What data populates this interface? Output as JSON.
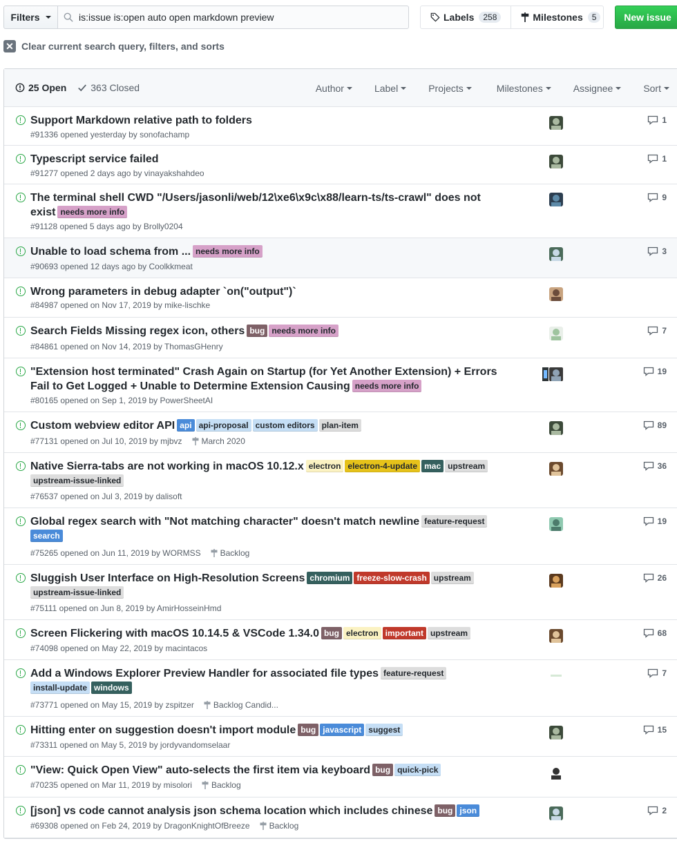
{
  "toolbar": {
    "filters_label": "Filters",
    "search_value": "is:issue is:open auto open markdown preview",
    "labels_label": "Labels",
    "labels_count": "258",
    "milestones_label": "Milestones",
    "milestones_count": "5",
    "new_issue_label": "New issue"
  },
  "clear_filters_label": "Clear current search query, filters, and sorts",
  "header": {
    "open_label": "25 Open",
    "closed_label": "363 Closed",
    "menus": [
      "Author",
      "Label",
      "Projects",
      "Milestones",
      "Assignee",
      "Sort"
    ]
  },
  "label_colors": {
    "needs more info": {
      "bg": "#d6a1c8",
      "fg": "#24292e"
    },
    "bug": {
      "bg": "#7e6167",
      "fg": "#ffffff"
    },
    "api": {
      "bg": "#4a8bd9",
      "fg": "#ffffff"
    },
    "api-proposal": {
      "bg": "#c5def5",
      "fg": "#24292e"
    },
    "custom editors": {
      "bg": "#c5def5",
      "fg": "#24292e"
    },
    "plan-item": {
      "bg": "#dddddd",
      "fg": "#24292e"
    },
    "electron": {
      "bg": "#fbf2c2",
      "fg": "#24292e"
    },
    "electron-4-update": {
      "bg": "#e6c21a",
      "fg": "#24292e"
    },
    "mac": {
      "bg": "#35605e",
      "fg": "#ffffff"
    },
    "upstream": {
      "bg": "#dddddd",
      "fg": "#24292e"
    },
    "upstream-issue-linked": {
      "bg": "#dddddd",
      "fg": "#24292e"
    },
    "feature-request": {
      "bg": "#dddddd",
      "fg": "#24292e"
    },
    "search": {
      "bg": "#4a8bd9",
      "fg": "#ffffff"
    },
    "chromium": {
      "bg": "#35605e",
      "fg": "#ffffff"
    },
    "freeze-slow-crash": {
      "bg": "#c0392b",
      "fg": "#ffffff"
    },
    "important": {
      "bg": "#c0392b",
      "fg": "#ffffff"
    },
    "install-update": {
      "bg": "#c5def5",
      "fg": "#24292e"
    },
    "windows": {
      "bg": "#35605e",
      "fg": "#ffffff"
    },
    "javascript": {
      "bg": "#4a8bd9",
      "fg": "#ffffff"
    },
    "suggest": {
      "bg": "#c5def5",
      "fg": "#24292e"
    },
    "quick-pick": {
      "bg": "#c5def5",
      "fg": "#24292e"
    },
    "json": {
      "bg": "#4a8bd9",
      "fg": "#ffffff"
    }
  },
  "issues": [
    {
      "title": "Support Markdown relative path to folders",
      "labels": [],
      "meta": "#91336 opened yesterday by sonofachamp",
      "milestone": "",
      "comments": "1"
    },
    {
      "title": "Typescript service failed",
      "labels": [],
      "meta": "#91277 opened 2 days ago by vinayakshahdeo",
      "milestone": "",
      "comments": "1"
    },
    {
      "title": "The terminal shell CWD \"/Users/jasonli/web/12\\xe6\\x9c\\x88/learn-ts/ts-crawl\" does not exist",
      "labels": [
        "needs more info"
      ],
      "meta": "#91128 opened 5 days ago by Brolly0204",
      "milestone": "",
      "comments": "9"
    },
    {
      "title": "Unable to load schema from ...",
      "labels": [
        "needs more info"
      ],
      "meta": "#90693 opened 12 days ago by Coolkkmeat",
      "milestone": "",
      "comments": "3"
    },
    {
      "title": "Wrong parameters in debug adapter `on(\"output\")`",
      "labels": [],
      "meta": "#84987 opened on Nov 17, 2019 by mike-lischke",
      "milestone": "",
      "comments": ""
    },
    {
      "title": "Search Fields Missing regex icon, others",
      "labels": [
        "bug",
        "needs more info"
      ],
      "meta": "#84861 opened on Nov 14, 2019 by ThomasGHenry",
      "milestone": "",
      "comments": "7"
    },
    {
      "title": "\"Extension host terminated\" Crash Again on Startup (for Yet Another Extension) + Errors Fail to Get Logged + Unable to Determine Extension Causing",
      "labels": [
        "needs more info"
      ],
      "meta": "#80165 opened on Sep 1, 2019 by PowerSheetAI",
      "milestone": "",
      "comments": "19"
    },
    {
      "title": "Custom webview editor API",
      "labels": [
        "api",
        "api-proposal",
        "custom editors",
        "plan-item"
      ],
      "meta": "#77131 opened on Jul 10, 2019 by mjbvz",
      "milestone": "March 2020",
      "comments": "89"
    },
    {
      "title": "Native Sierra-tabs are not working in macOS 10.12.x",
      "labels": [
        "electron",
        "electron-4-update",
        "mac",
        "upstream",
        "upstream-issue-linked"
      ],
      "meta": "#76537 opened on Jul 3, 2019 by dalisoft",
      "milestone": "",
      "comments": "36"
    },
    {
      "title": "Global regex search with \"Not matching character\" doesn't match newline",
      "labels": [
        "feature-request",
        "search"
      ],
      "meta": "#75265 opened on Jun 11, 2019 by WORMSS",
      "milestone": "Backlog",
      "comments": "19"
    },
    {
      "title": "Sluggish User Interface on High-Resolution Screens",
      "labels": [
        "chromium",
        "freeze-slow-crash",
        "upstream",
        "upstream-issue-linked"
      ],
      "meta": "#75111 opened on Jun 8, 2019 by AmirHosseinHmd",
      "milestone": "",
      "comments": "26"
    },
    {
      "title": "Screen Flickering with macOS 10.14.5 & VSCode 1.34.0",
      "labels": [
        "bug",
        "electron",
        "important",
        "upstream"
      ],
      "meta": "#74098 opened on May 22, 2019 by macintacos",
      "milestone": "",
      "comments": "68"
    },
    {
      "title": "Add a Windows Explorer Preview Handler for associated file types",
      "labels": [
        "feature-request",
        "install-update",
        "windows"
      ],
      "meta": "#73771 opened on May 15, 2019 by zspitzer",
      "milestone": "Backlog Candid...",
      "comments": "7"
    },
    {
      "title": "Hitting enter on suggestion doesn't import module",
      "labels": [
        "bug",
        "javascript",
        "suggest"
      ],
      "meta": "#73311 opened on May 5, 2019 by jordyvandomselaar",
      "milestone": "",
      "comments": "15"
    },
    {
      "title": "\"View: Quick Open View\" auto-selects the first item via keyboard",
      "labels": [
        "bug",
        "quick-pick"
      ],
      "meta": "#70235 opened on Mar 11, 2019 by misolori",
      "milestone": "Backlog",
      "comments": ""
    },
    {
      "title": "[json] vs code cannot analysis json schema location which includes chinese",
      "labels": [
        "bug",
        "json"
      ],
      "meta": "#69308 opened on Feb 24, 2019 by DragonKnightOfBreeze",
      "milestone": "Backlog",
      "comments": "2"
    }
  ]
}
